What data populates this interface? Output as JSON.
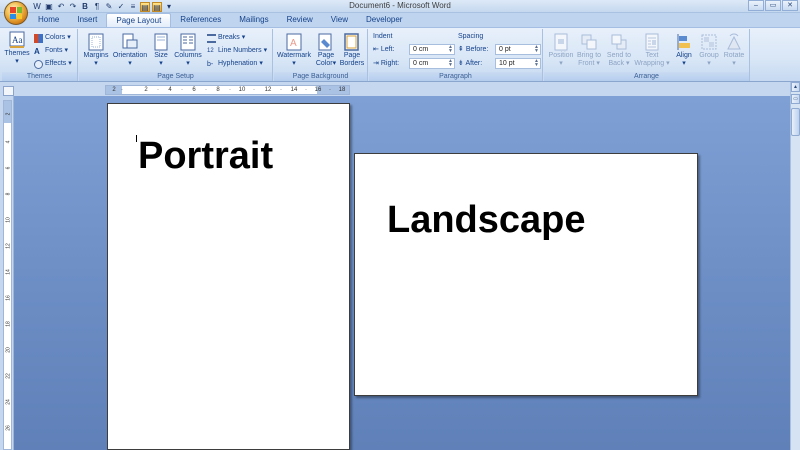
{
  "window": {
    "title": "Document6 - Microsoft Word",
    "controls": [
      "–",
      "▭",
      "✕"
    ]
  },
  "qat": {
    "icons": [
      "word-icon",
      "save-icon",
      "undo-icon",
      "redo-icon",
      "bold-icon",
      "paragraph-mark-icon",
      "format-painter-icon",
      "spelling-icon",
      "highlight-icon",
      "selected-format-icon",
      "customize-icon"
    ]
  },
  "tabs": [
    {
      "label": "Home"
    },
    {
      "label": "Insert"
    },
    {
      "label": "Page Layout",
      "active": true
    },
    {
      "label": "References"
    },
    {
      "label": "Mailings"
    },
    {
      "label": "Review"
    },
    {
      "label": "View"
    },
    {
      "label": "Developer"
    }
  ],
  "ribbon": {
    "themes": {
      "label": "Themes",
      "themes_btn": "Themes",
      "colors_btn": "Colors",
      "fonts_btn": "Fonts",
      "effects_btn": "Effects"
    },
    "page_setup": {
      "label": "Page Setup",
      "margins_btn": "Margins",
      "orientation_btn": "Orientation",
      "size_btn": "Size",
      "columns_btn": "Columns",
      "breaks_btn": "Breaks",
      "line_numbers_btn": "Line Numbers",
      "hyphenation_btn": "Hyphenation"
    },
    "page_background": {
      "label": "Page Background",
      "watermark_btn": "Watermark",
      "page_color_btn": [
        "Page",
        "Color"
      ],
      "page_borders_btn": [
        "Page",
        "Borders"
      ]
    },
    "paragraph": {
      "label": "Paragraph",
      "indent_head": "Indent",
      "spacing_head": "Spacing",
      "left_label": "Left:",
      "left_value": "0 cm",
      "right_label": "Right:",
      "right_value": "0 cm",
      "before_label": "Before:",
      "before_value": "0 pt",
      "after_label": "After:",
      "after_value": "10 pt"
    },
    "arrange": {
      "label": "Arrange",
      "position_btn": "Position",
      "bring_front_btn": [
        "Bring to",
        "Front"
      ],
      "send_back_btn": [
        "Send to",
        "Back"
      ],
      "text_wrapping_btn": [
        "Text",
        "Wrapping"
      ],
      "align_btn": "Align",
      "group_btn": "Group",
      "rotate_btn": "Rotate"
    }
  },
  "hruler": {
    "ticks": [
      "2",
      "·",
      "2",
      "·",
      "4",
      "·",
      "6",
      "·",
      "8",
      "·",
      "10",
      "·",
      "12",
      "·",
      "14",
      "·",
      "16",
      "·",
      "18"
    ]
  },
  "vruler": {
    "ticks": [
      "2",
      "4",
      "6",
      "8",
      "10",
      "12",
      "14",
      "16",
      "18",
      "20",
      "22",
      "24",
      "26"
    ]
  },
  "document": {
    "portrait_text": "Portrait",
    "landscape_text": "Landscape"
  },
  "colors": {
    "ribbon_text": "#15428b",
    "workspace": "#6d8fc6",
    "page": "#ffffff"
  }
}
